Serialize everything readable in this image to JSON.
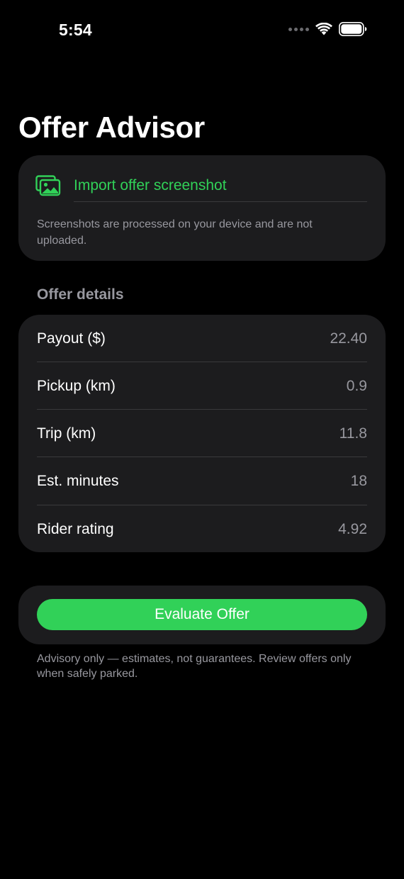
{
  "status_bar": {
    "time": "5:54"
  },
  "title": "Offer Advisor",
  "import": {
    "label": "Import offer screenshot",
    "note": "Screenshots are processed on your device and are not uploaded.",
    "icon": "photo-stack-icon"
  },
  "offer_details": {
    "header": "Offer details",
    "rows": [
      {
        "label": "Payout ($)",
        "value": "22.40"
      },
      {
        "label": "Pickup (km)",
        "value": "0.9"
      },
      {
        "label": "Trip (km)",
        "value": "11.8"
      },
      {
        "label": "Est. minutes",
        "value": "18"
      },
      {
        "label": "Rider rating",
        "value": "4.92"
      }
    ]
  },
  "evaluate_label": "Evaluate Offer",
  "disclaimer": "Advisory only — estimates, not guarantees. Review offers only when safely parked.",
  "colors": {
    "accent": "#31d158",
    "card_background": "#1c1c1e",
    "secondary_text": "#98989f",
    "background": "#000000"
  }
}
